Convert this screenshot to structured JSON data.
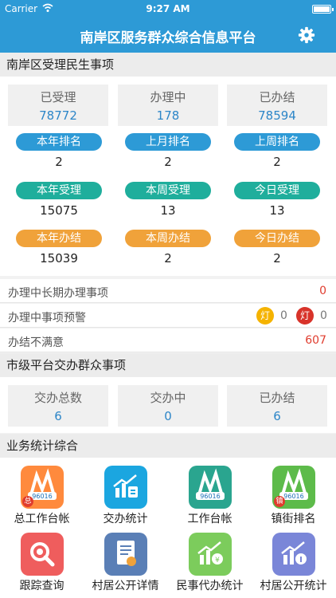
{
  "status_bar": {
    "carrier": "Carrier",
    "time": "9:27 AM"
  },
  "nav": {
    "title": "南岸区服务群众综合信息平台",
    "settings_icon": "gear-icon"
  },
  "section1": {
    "title": "南岸区受理民生事项",
    "stats": [
      {
        "label": "已受理",
        "value": "78772"
      },
      {
        "label": "办理中",
        "value": "178"
      },
      {
        "label": "已办结",
        "value": "78594"
      }
    ],
    "ranking": [
      {
        "label": "本年排名",
        "value": "2"
      },
      {
        "label": "上月排名",
        "value": "2"
      },
      {
        "label": "上周排名",
        "value": "2"
      }
    ],
    "accepted": [
      {
        "label": "本年受理",
        "value": "15075"
      },
      {
        "label": "本周受理",
        "value": "13"
      },
      {
        "label": "今日受理",
        "value": "13"
      }
    ],
    "completed": [
      {
        "label": "本年办结",
        "value": "15039"
      },
      {
        "label": "本周办结",
        "value": "2"
      },
      {
        "label": "今日办结",
        "value": "2"
      }
    ]
  },
  "rows": {
    "long_term": {
      "label": "办理中长期办理事项",
      "value": "0"
    },
    "warning": {
      "label": "办理中事项预警",
      "yellow_lamp": "灯",
      "yellow_count": "0",
      "red_lamp": "灯",
      "red_count": "0"
    },
    "unsatisfied": {
      "label": "办结不满意",
      "value": "607"
    }
  },
  "section2": {
    "title": "市级平台交办群众事项",
    "stats": [
      {
        "label": "交办总数",
        "value": "6"
      },
      {
        "label": "交办中",
        "value": "0"
      },
      {
        "label": "已办结",
        "value": "6"
      }
    ]
  },
  "section3": {
    "title": "业务统计综合",
    "tiles": [
      {
        "label": "总工作台帐",
        "icon": "logo-96016-icon",
        "badge": "总",
        "color": "#ff8a3d"
      },
      {
        "label": "交办统计",
        "icon": "chart-document-icon",
        "color": "#1ba6e0"
      },
      {
        "label": "工作台帐",
        "icon": "logo-96016-icon",
        "color": "#2aa58f"
      },
      {
        "label": "镇街排名",
        "icon": "logo-96016-icon",
        "badge": "镇",
        "color": "#5dbb4a"
      },
      {
        "label": "跟踪查询",
        "icon": "search-gear-icon",
        "color": "#ef5d5d"
      },
      {
        "label": "村居公开详情",
        "icon": "document-icon",
        "color": "#5a7fb6"
      },
      {
        "label": "民事代办统计",
        "icon": "chart-money-icon",
        "color": "#7ccc5c"
      },
      {
        "label": "村居公开统计",
        "icon": "chart-info-icon",
        "color": "#7a86d8"
      }
    ]
  }
}
